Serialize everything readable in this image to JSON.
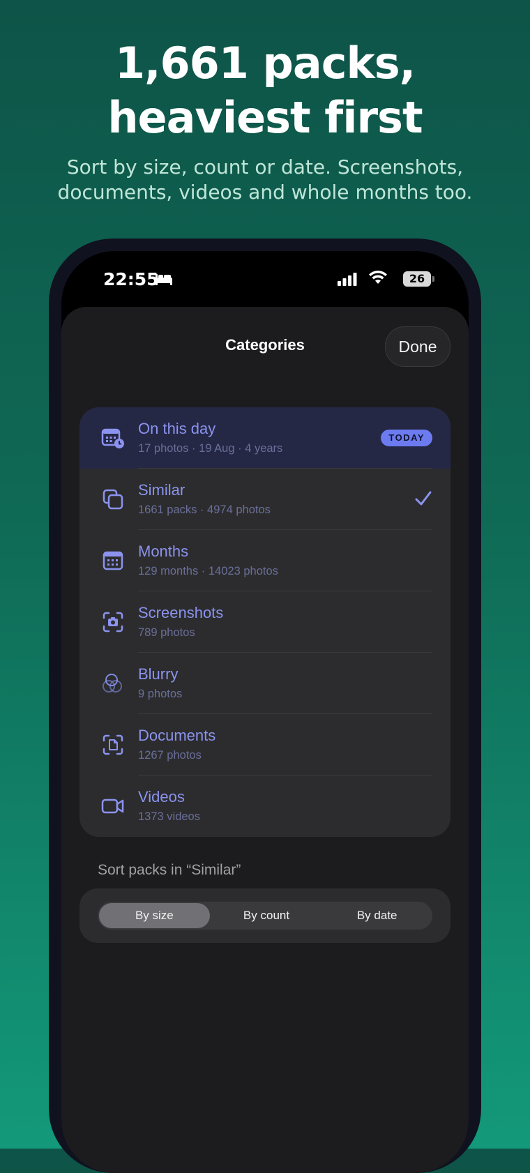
{
  "hero": {
    "title_line1": "1,661 packs,",
    "title_line2": "heaviest first",
    "subtitle_line1": "Sort by size, count or date. Screenshots,",
    "subtitle_line2": "documents, videos and whole months too."
  },
  "status_bar": {
    "time": "22:55",
    "battery": "26",
    "icons": [
      "bed-icon",
      "cellular-signal-icon",
      "wifi-icon",
      "battery-icon"
    ]
  },
  "sheet": {
    "title": "Categories",
    "done_label": "Done"
  },
  "categories": [
    {
      "title": "On this day",
      "subtitle": "17 photos · 19 Aug · 4 years",
      "icon": "calendar-clock-icon",
      "badge": "TODAY"
    },
    {
      "title": "Similar",
      "subtitle": "1661 packs · 4974 photos",
      "icon": "stacked-squares-icon",
      "selected": true
    },
    {
      "title": "Months",
      "subtitle": "129 months · 14023 photos",
      "icon": "calendar-icon"
    },
    {
      "title": "Screenshots",
      "subtitle": "789 photos",
      "icon": "screenshot-camera-icon"
    },
    {
      "title": "Blurry",
      "subtitle": "9 photos",
      "icon": "blurry-circles-icon"
    },
    {
      "title": "Documents",
      "subtitle": "1267 photos",
      "icon": "document-scan-icon"
    },
    {
      "title": "Videos",
      "subtitle": "1373 videos",
      "icon": "video-camera-icon"
    }
  ],
  "sort": {
    "label": "Sort packs in “Similar”",
    "options": [
      "By size",
      "By count",
      "By date"
    ],
    "selected": "By size"
  },
  "colors": {
    "accent": "#8b93ee",
    "badge": "#6c7cf0",
    "sheet_bg": "#1c1c1e",
    "card_bg": "#2c2c2e"
  }
}
